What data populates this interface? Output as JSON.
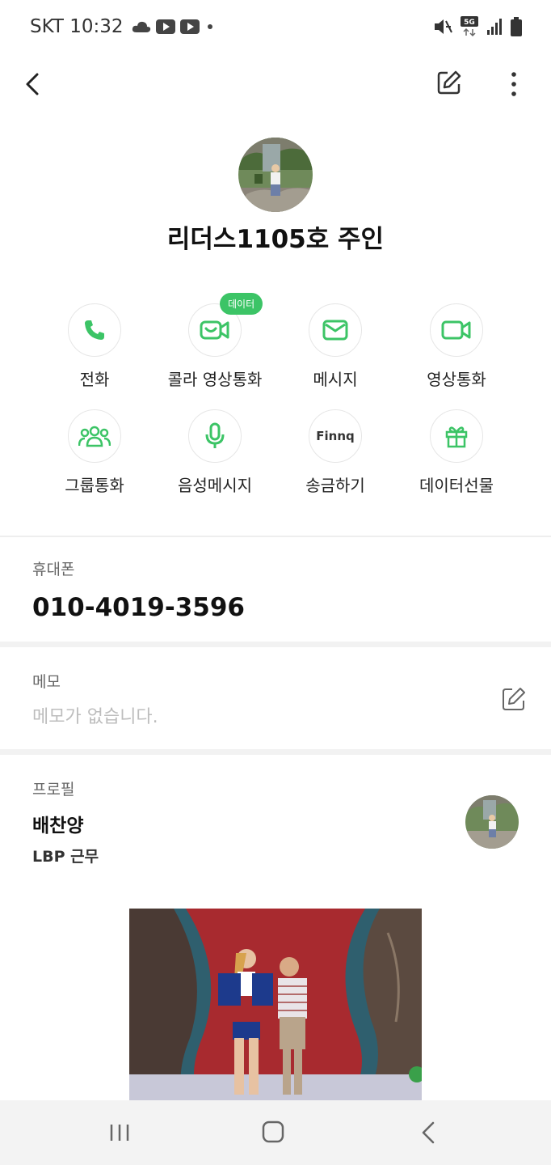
{
  "status_bar": {
    "carrier": "SKT",
    "time": "10:32",
    "left_icons": [
      "cloud-icon",
      "youtube-icon",
      "youtube-icon",
      "dot-icon"
    ],
    "right_icons": [
      "mute-icon",
      "5g-icon",
      "signal-icon",
      "battery-icon"
    ],
    "network": "5G"
  },
  "app_bar": {
    "icons": [
      "back-icon",
      "edit-icon",
      "more-icon"
    ]
  },
  "profile": {
    "name": "리더스1105호 주인"
  },
  "actions": [
    {
      "label": "전화",
      "icon": "phone-icon"
    },
    {
      "label": "콜라 영상통화",
      "icon": "video-call-icon",
      "badge": "데이터"
    },
    {
      "label": "메시지",
      "icon": "message-icon"
    },
    {
      "label": "영상통화",
      "icon": "video-icon"
    },
    {
      "label": "그룹통화",
      "icon": "group-call-icon"
    },
    {
      "label": "음성메시지",
      "icon": "mic-icon"
    },
    {
      "label": "송금하기",
      "icon": "finnq-logo",
      "logo_text": "Finnq"
    },
    {
      "label": "데이터선물",
      "icon": "gift-icon"
    }
  ],
  "phone_section": {
    "label": "휴대폰",
    "number": "010-4019-3596"
  },
  "memo_section": {
    "label": "메모",
    "placeholder": "메모가 없습니다."
  },
  "profile_section": {
    "label": "프로필",
    "name": "배찬양",
    "work": "LBP 근무"
  },
  "nav_bar": {
    "icons": [
      "recents-icon",
      "home-icon",
      "back-nav-icon"
    ]
  },
  "colors": {
    "accent_green": "#3cc466",
    "divider": "#eeeeee",
    "nav_bg": "#f3f3f3"
  }
}
